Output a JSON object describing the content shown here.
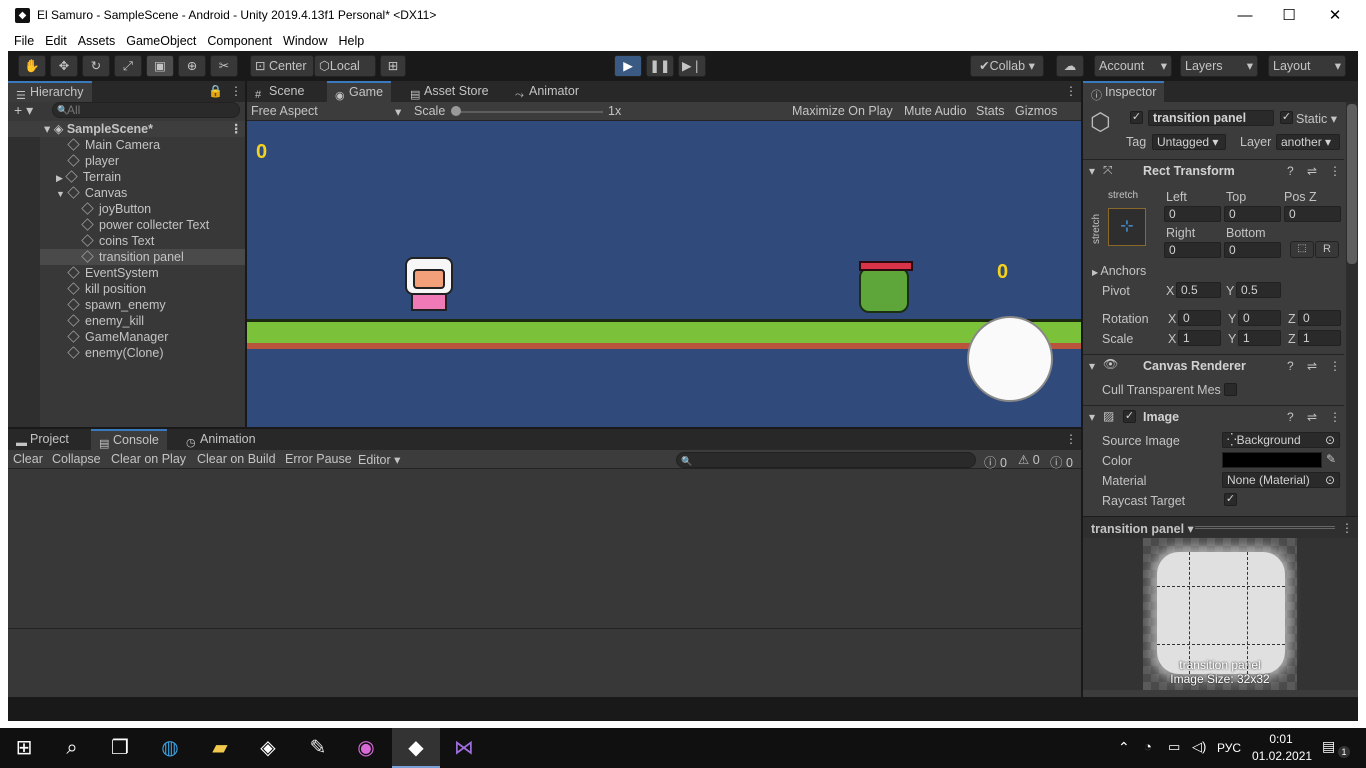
{
  "window": {
    "title": "El Samuro - SampleScene - Android - Unity 2019.4.13f1 Personal* <DX11>",
    "minimize": "—",
    "maximize": "☐",
    "close": "✕"
  },
  "menu": [
    "File",
    "Edit",
    "Assets",
    "GameObject",
    "Component",
    "Window",
    "Help"
  ],
  "toolbar": {
    "center": "Center",
    "local": "Local",
    "collab": "Collab",
    "account": "Account",
    "layers": "Layers",
    "layout": "Layout",
    "dropdown": "▾"
  },
  "hierarchy": {
    "tab": "Hierarchy",
    "search_placeholder": "All",
    "add": "+ ▾",
    "scene": "SampleScene*",
    "items": [
      {
        "label": "Main Camera"
      },
      {
        "label": "player"
      },
      {
        "label": "Terrain"
      },
      {
        "label": "Canvas"
      },
      {
        "label": "joyButton"
      },
      {
        "label": "power collecter Text"
      },
      {
        "label": "coins Text"
      },
      {
        "label": "transition panel"
      },
      {
        "label": "EventSystem"
      },
      {
        "label": "kill position"
      },
      {
        "label": "spawn_enemy"
      },
      {
        "label": "enemy_kill"
      },
      {
        "label": "GameManager"
      },
      {
        "label": "enemy(Clone)"
      }
    ]
  },
  "game": {
    "tabs": [
      "Scene",
      "Game",
      "Asset Store",
      "Animator"
    ],
    "aspect": "Free Aspect",
    "scale_label": "Scale",
    "scale_value": "1x",
    "maximize": "Maximize On Play",
    "mute": "Mute Audio",
    "stats": "Stats",
    "gizmos": "Gizmos",
    "score_left": "0",
    "score_right": "0",
    "colors": {
      "sky": "#2f4a7b",
      "grass": "#7cc13a",
      "score": "#f5d21b"
    }
  },
  "bottom": {
    "tabs": [
      "Project",
      "Console",
      "Animation"
    ],
    "buttons": [
      "Clear",
      "Collapse",
      "Clear on Play",
      "Clear on Build",
      "Error Pause",
      "Editor"
    ],
    "counts": [
      "0",
      "0",
      "0"
    ]
  },
  "inspector": {
    "tab": "Inspector",
    "name": "transition panel",
    "static": "Static",
    "tag_label": "Tag",
    "tag": "Untagged",
    "layer_label": "Layer",
    "layer": "another",
    "rect": {
      "title": "Rect Transform",
      "stretch": "stretch",
      "left_label": "Left",
      "top_label": "Top",
      "posz_label": "Pos Z",
      "left": "0",
      "top": "0",
      "posz": "0",
      "right_label": "Right",
      "bottom_label": "Bottom",
      "right": "0",
      "bottom": "0",
      "r": "R",
      "anchors": "Anchors",
      "pivot": "Pivot",
      "pivot_x": "0.5",
      "pivot_y": "0.5",
      "rotation": "Rotation",
      "rot_x": "0",
      "rot_y": "0",
      "rot_z": "0",
      "scale": "Scale",
      "scale_x": "1",
      "scale_y": "1",
      "scale_z": "1",
      "x": "X",
      "y": "Y",
      "z": "Z"
    },
    "canvas_renderer": {
      "title": "Canvas Renderer",
      "cull": "Cull Transparent Mes"
    },
    "image": {
      "title": "Image",
      "source_label": "Source Image",
      "source": "Background",
      "color_label": "Color",
      "material_label": "Material",
      "material": "None (Material)",
      "raycast_label": "Raycast Target"
    },
    "preview": {
      "title": "transition panel",
      "caption": "transition panel",
      "size": "Image Size: 32x32"
    }
  },
  "taskbar": {
    "lang": "РУС",
    "time": "0:01",
    "date": "01.02.2021",
    "notif": "1"
  }
}
